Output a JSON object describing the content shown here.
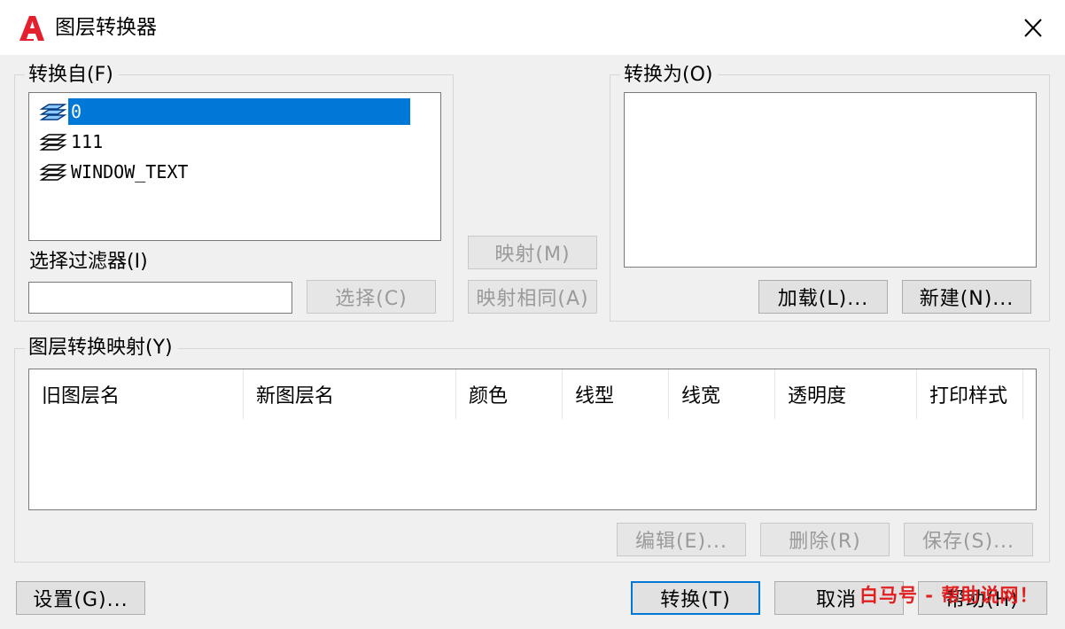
{
  "window": {
    "title": "图层转换器",
    "app_icon": "autocad-logo-icon",
    "close_icon": "close-icon"
  },
  "convert_from": {
    "label": "转换自(F)",
    "layers": [
      {
        "name": "0",
        "selected": true
      },
      {
        "name": "111",
        "selected": false
      },
      {
        "name": "WINDOW_TEXT",
        "selected": false
      }
    ],
    "filter_label": "选择过滤器(I)",
    "filter_value": "",
    "select_button": "选择(C)"
  },
  "middle": {
    "map_button": "映射(M)",
    "map_same_button": "映射相同(A)"
  },
  "convert_to": {
    "label": "转换为(O)",
    "load_button": "加载(L)...",
    "new_button": "新建(N)..."
  },
  "mapping": {
    "label": "图层转换映射(Y)",
    "columns": [
      "旧图层名",
      "新图层名",
      "颜色",
      "线型",
      "线宽",
      "透明度",
      "打印样式"
    ],
    "edit_button": "编辑(E)...",
    "delete_button": "删除(R)",
    "save_button": "保存(S)..."
  },
  "footer": {
    "settings_button": "设置(G)...",
    "convert_button": "转换(T)",
    "cancel_button": "取消",
    "help_button": "帮助(H)"
  },
  "watermark": "白马号 - 帮助说网！",
  "colors": {
    "selection": "#0078d7",
    "accent_logo": "#e4202e",
    "watermark": "#e02020"
  }
}
